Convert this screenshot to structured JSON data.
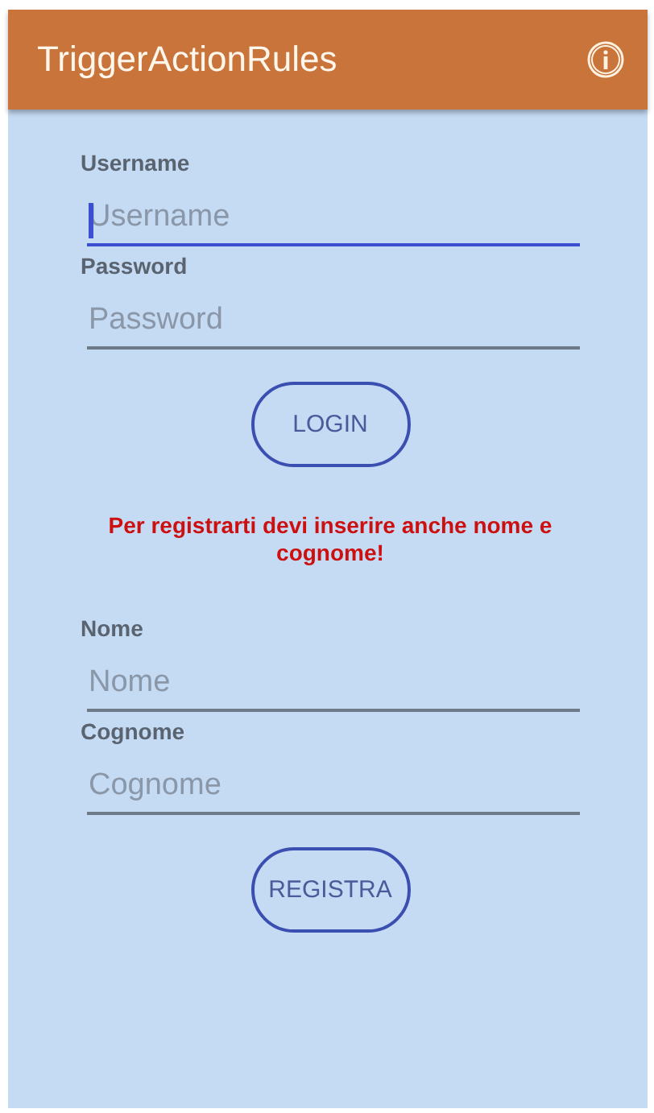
{
  "app_bar": {
    "title": "TriggerActionRules"
  },
  "form": [
    {
      "kind": "field",
      "label": "Username",
      "placeholder": "Username",
      "focused": true
    },
    {
      "kind": "field",
      "label": "Password",
      "placeholder": "Password",
      "focused": false
    },
    {
      "kind": "button",
      "label": "LOGIN"
    },
    {
      "kind": "message",
      "text": "Per registrarti devi inserire anche nome e cognome!"
    },
    {
      "kind": "field",
      "label": "Nome",
      "placeholder": "Nome",
      "focused": false
    },
    {
      "kind": "field",
      "label": "Cognome",
      "placeholder": "Cognome",
      "focused": false
    },
    {
      "kind": "button",
      "label": "REGISTRA"
    }
  ]
}
